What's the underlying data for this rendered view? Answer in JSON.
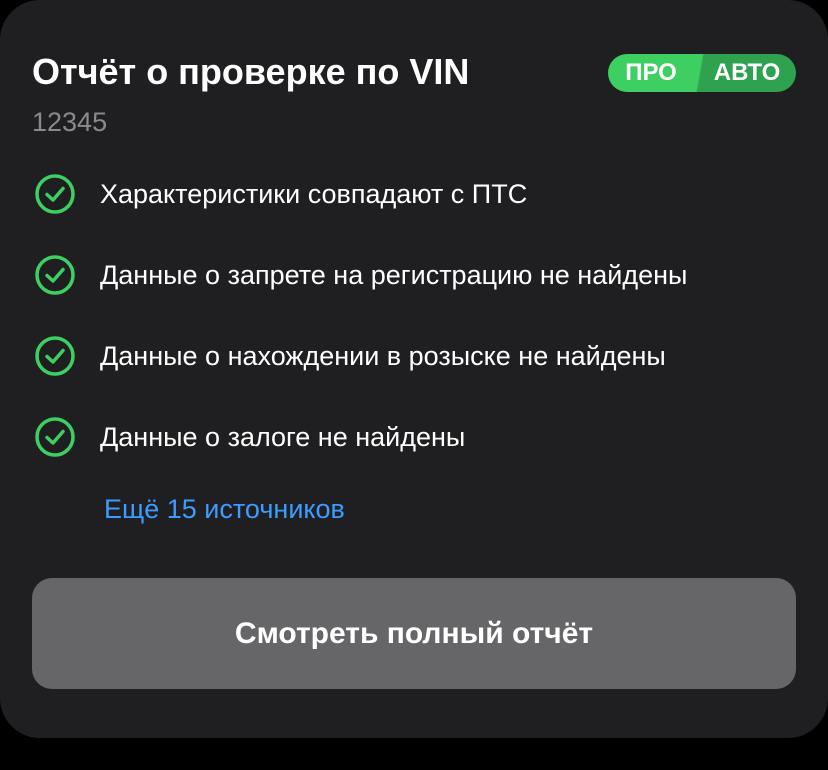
{
  "card": {
    "title": "Отчёт о проверке по VIN",
    "vin": "12345",
    "badge": {
      "pro": "ПРО",
      "avto": "АВТО",
      "pro_color": "#3ecf63",
      "avto_color": "#2ea24f"
    },
    "checks": [
      {
        "label": "Характеристики совпадают с ПТС",
        "icon": "check-circle-icon"
      },
      {
        "label": "Данные о запрете на регистрацию не найдены",
        "icon": "check-circle-icon"
      },
      {
        "label": "Данные о нахождении в розыске не найдены",
        "icon": "check-circle-icon"
      },
      {
        "label": "Данные о залоге не найдены",
        "icon": "check-circle-icon"
      }
    ],
    "more_link": "Ещё 15 источников",
    "button_label": "Смотреть полный отчёт"
  },
  "colors": {
    "background": "#1f1f21",
    "check_green": "#3ecf63",
    "link_blue": "#3d9cff",
    "button": "#666668"
  }
}
